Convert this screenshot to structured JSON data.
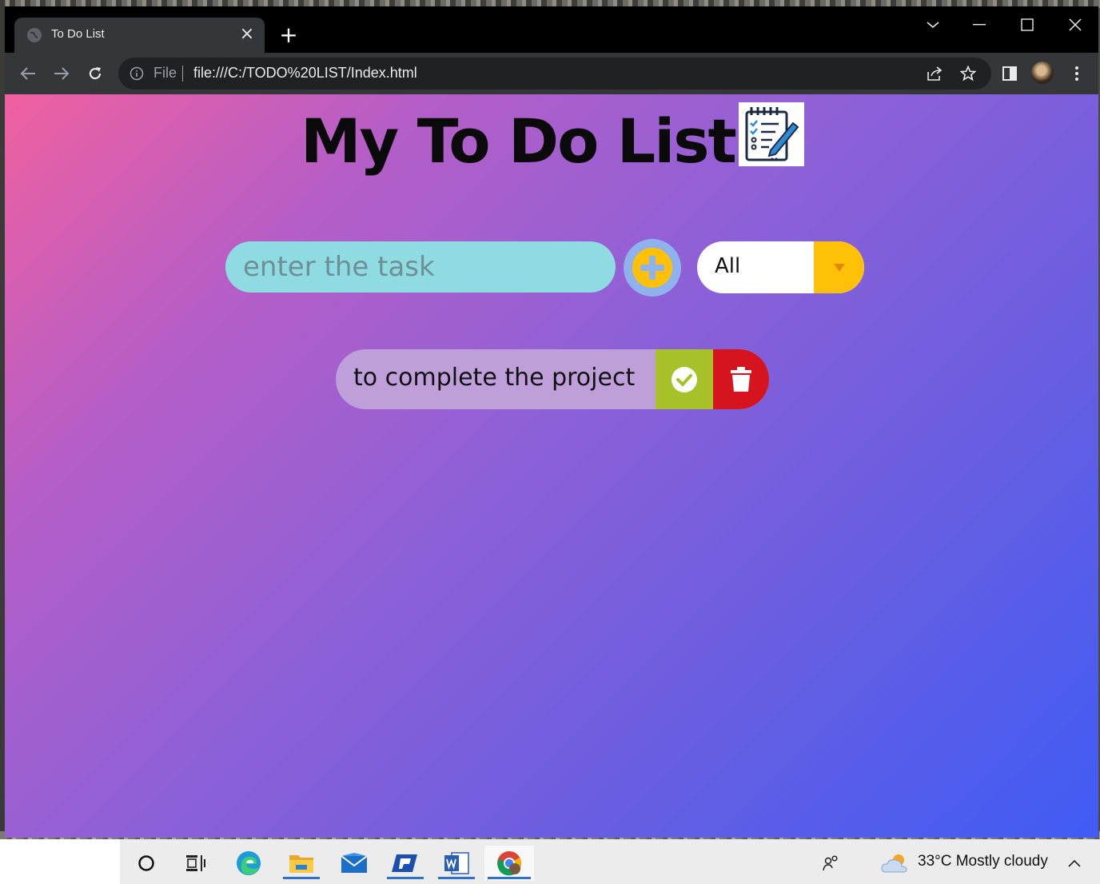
{
  "browser": {
    "tab_title": "To Do List",
    "tab_close": "×",
    "new_tab": "+",
    "omnibox": {
      "scheme_label": "File",
      "url": "file:///C:/TODO%20LIST/Index.html"
    }
  },
  "page": {
    "heading": "My To Do List",
    "task_input_placeholder": "enter the task",
    "filter": {
      "selected": "All"
    },
    "todos": [
      {
        "text": "to complete the project"
      }
    ],
    "colors": {
      "gradient_start": "#f0609f",
      "gradient_end": "#3f5cf5",
      "input_bg": "#8edbe2",
      "add_button": "#ffc107",
      "complete_button": "#a7c229",
      "trash_button": "#d5141d"
    }
  },
  "taskbar": {
    "weather": "33°C  Mostly cloudy",
    "icons": [
      "cortana-icon",
      "task-view-icon",
      "edge-icon",
      "file-explorer-icon",
      "mail-icon",
      "app-icon",
      "word-icon",
      "chrome-icon"
    ]
  }
}
